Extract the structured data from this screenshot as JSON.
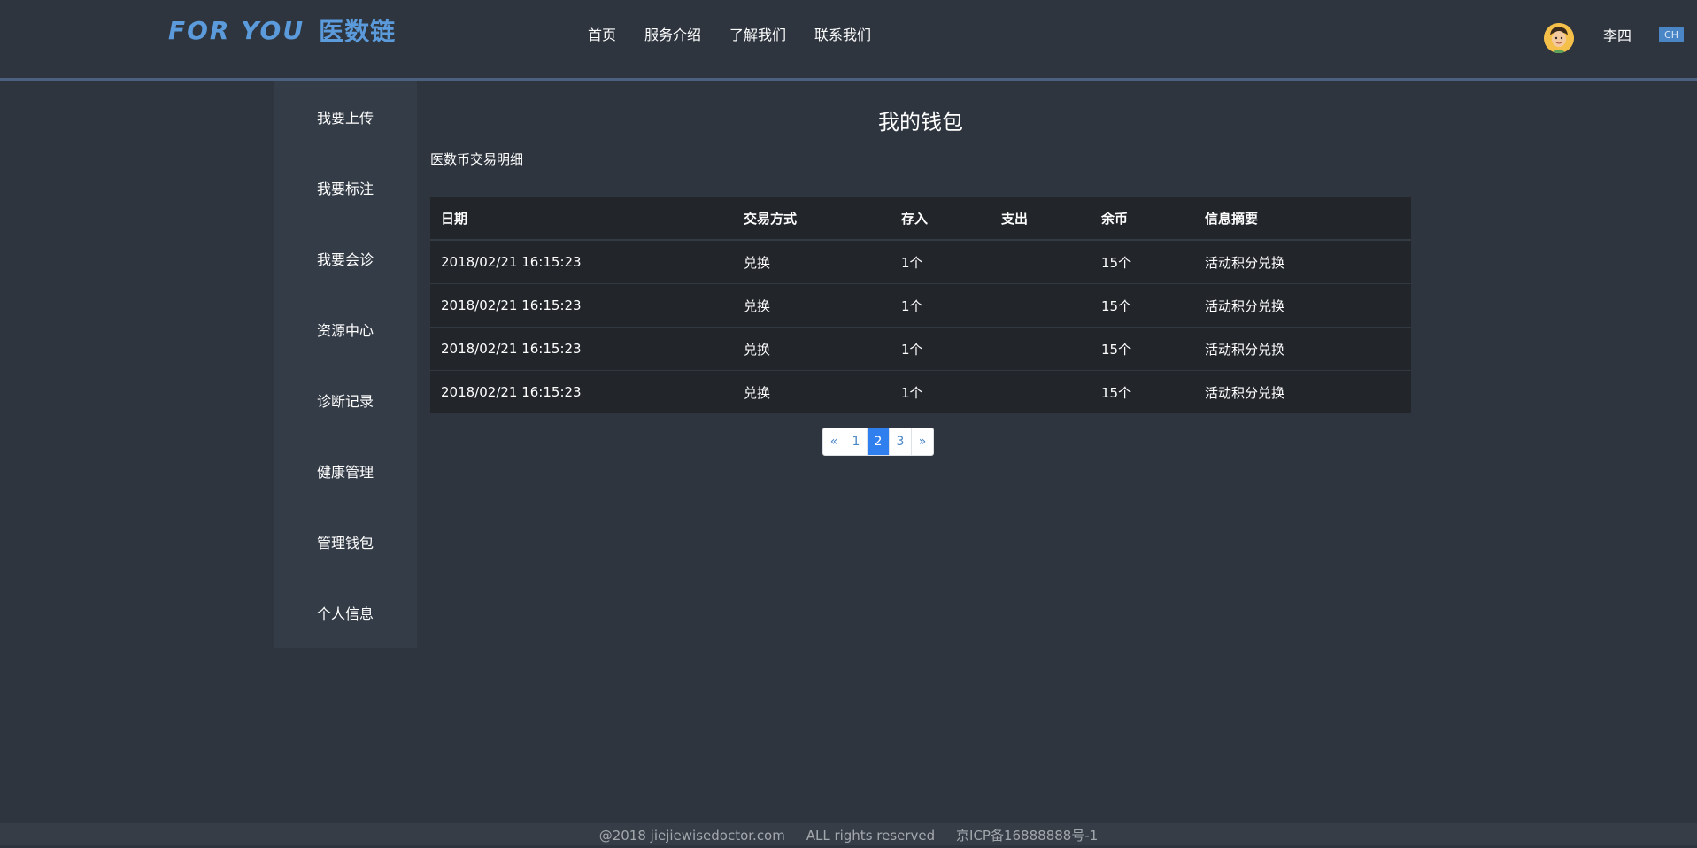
{
  "header": {
    "logo_text": "FOR YOU",
    "logo_cn": "医数链",
    "nav": [
      "首页",
      "服务介绍",
      "了解我们",
      "联系我们"
    ],
    "username": "李四",
    "lang": "CH"
  },
  "sidebar": {
    "items": [
      "我要上传",
      "我要标注",
      "我要会诊",
      "资源中心",
      "诊断记录",
      "健康管理",
      "管理钱包",
      "个人信息"
    ]
  },
  "main": {
    "title": "我的钱包",
    "section_title": "医数币交易明细",
    "table": {
      "headers": [
        "日期",
        "交易方式",
        "存入",
        "支出",
        "余币",
        "信息摘要"
      ],
      "rows": [
        [
          "2018/02/21 16:15:23",
          "兑换",
          "1个",
          "",
          "15个",
          "活动积分兑换"
        ],
        [
          "2018/02/21 16:15:23",
          "兑换",
          "1个",
          "",
          "15个",
          "活动积分兑换"
        ],
        [
          "2018/02/21 16:15:23",
          "兑换",
          "1个",
          "",
          "15个",
          "活动积分兑换"
        ],
        [
          "2018/02/21 16:15:23",
          "兑换",
          "1个",
          "",
          "15个",
          "活动积分兑换"
        ]
      ]
    },
    "pagination": {
      "prev": "«",
      "pages": [
        "1",
        "2",
        "3"
      ],
      "active_page": "2",
      "next": "»"
    }
  },
  "footer": {
    "copyright": "@2018 jiejiewisedoctor.com",
    "rights": "ALL rights reserved",
    "icp": "京ICP备16888888号-1"
  }
}
